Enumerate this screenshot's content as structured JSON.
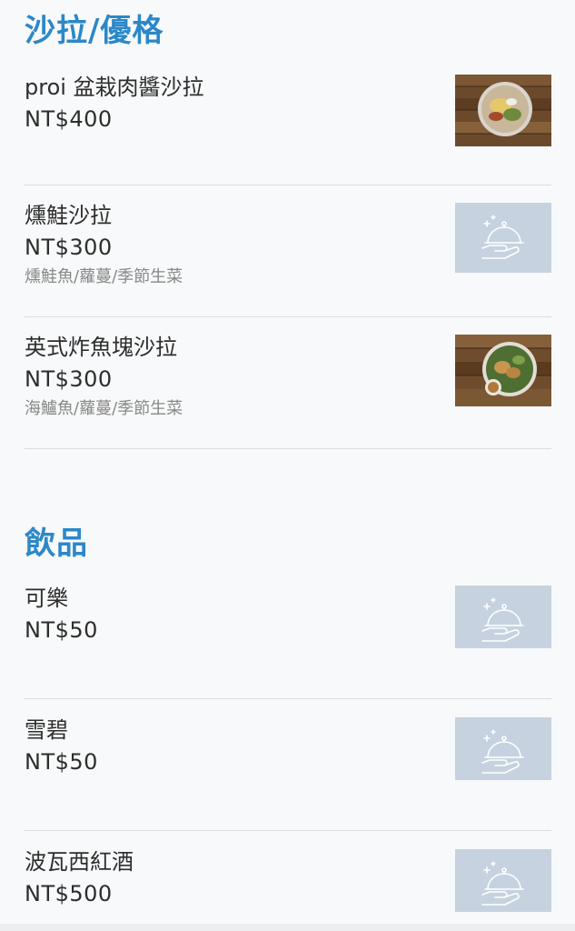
{
  "sections": {
    "salad": {
      "title": "沙拉/優格",
      "items": [
        {
          "name": "proi 盆栽肉醬沙拉",
          "price": "NT$400",
          "description": "",
          "image": "food-photo"
        },
        {
          "name": "燻鮭沙拉",
          "price": "NT$300",
          "description": "燻鮭魚/蘿蔓/季節生菜",
          "image": "placeholder-cloche-icon"
        },
        {
          "name": "英式炸魚塊沙拉",
          "price": "NT$300",
          "description": "海鱸魚/蘿蔓/季節生菜",
          "image": "food-photo"
        }
      ]
    },
    "drinks": {
      "title": "飲品",
      "items": [
        {
          "name": "可樂",
          "price": "NT$50",
          "image": "placeholder-cloche-icon"
        },
        {
          "name": "雪碧",
          "price": "NT$50",
          "image": "placeholder-cloche-icon"
        },
        {
          "name": "波瓦西紅酒",
          "price": "NT$500",
          "image": "placeholder-cloche-icon"
        }
      ]
    }
  },
  "colors": {
    "accent": "#2b88c8",
    "placeholder_bg": "#c6d2df",
    "divider": "#dcdcdc",
    "description": "#888888"
  }
}
